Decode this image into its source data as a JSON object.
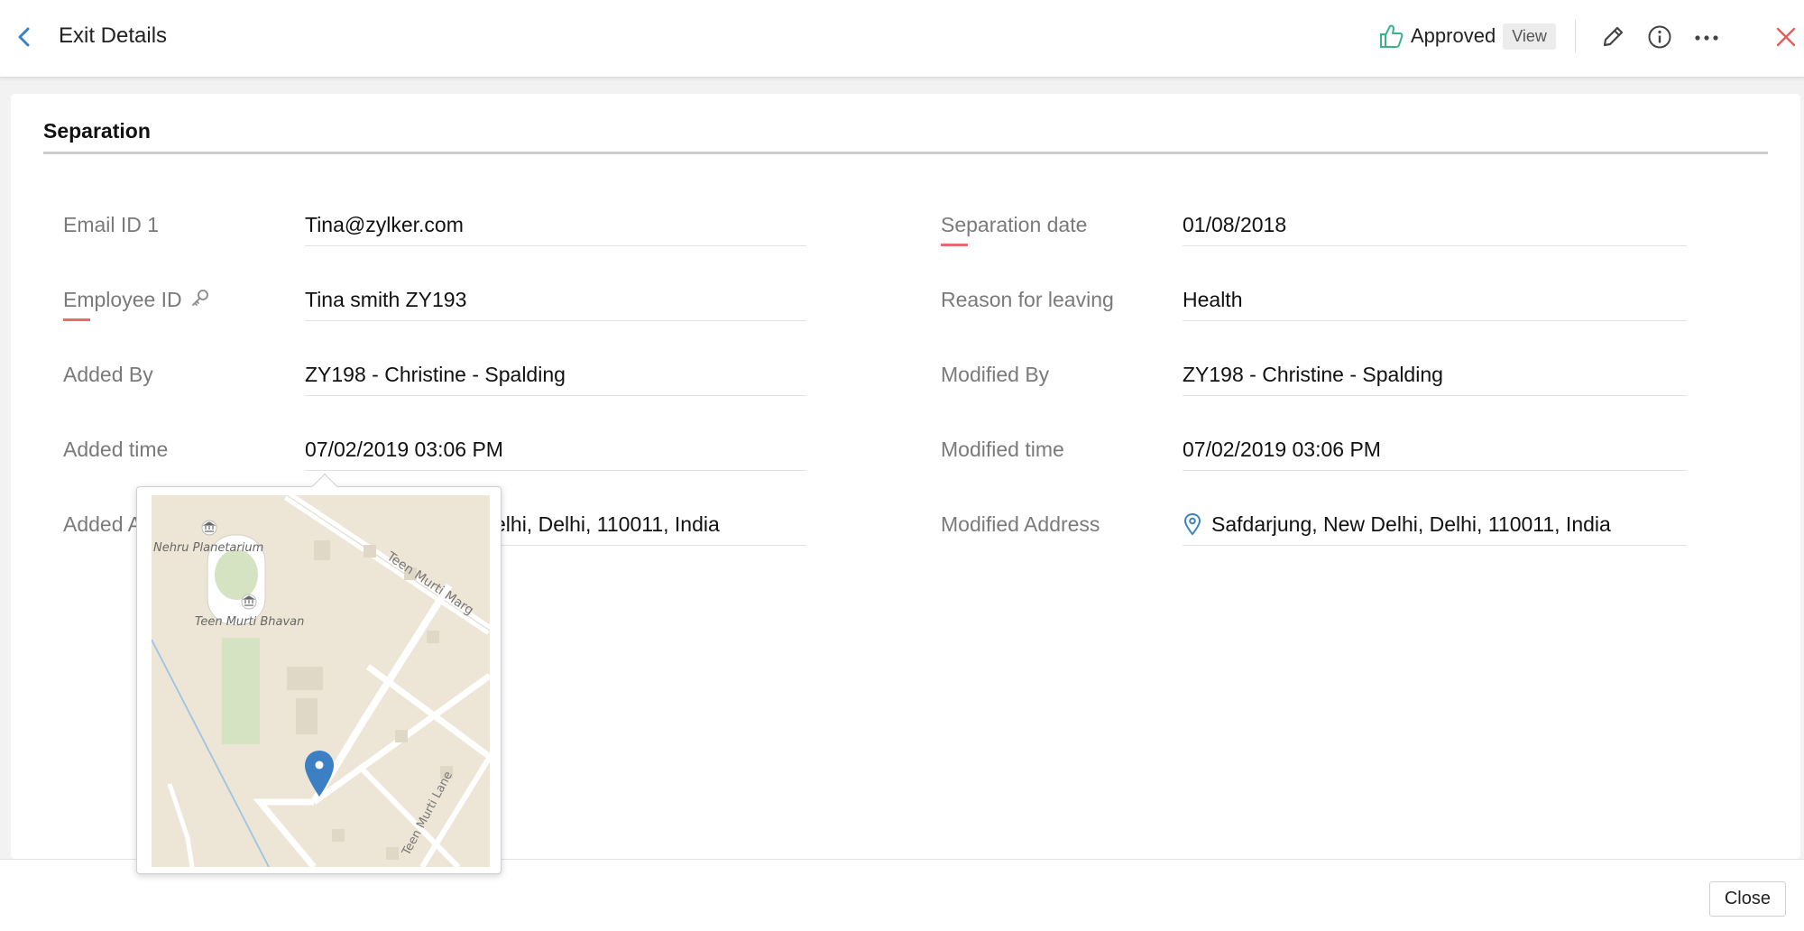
{
  "header": {
    "title": "Exit Details",
    "status": "Approved",
    "view_label": "View"
  },
  "section": {
    "title": "Separation"
  },
  "left_fields": [
    {
      "label": "Email ID 1",
      "value": "Tina@zylker.com"
    },
    {
      "label": "Employee ID",
      "value": "Tina smith ZY193"
    },
    {
      "label": "Added By",
      "value": "ZY198 - Christine - Spalding"
    },
    {
      "label": "Added time",
      "value": "07/02/2019 03:06 PM"
    },
    {
      "label": "Added A",
      "value": "elhi, Delhi, 110011, India"
    }
  ],
  "right_fields": [
    {
      "label": "Separation date",
      "value": "01/08/2018"
    },
    {
      "label": "Reason for leaving",
      "value": "Health"
    },
    {
      "label": "Modified By",
      "value": "ZY198 - Christine - Spalding"
    },
    {
      "label": "Modified time",
      "value": "07/02/2019 03:06 PM"
    },
    {
      "label": "Modified Address",
      "value": "Safdarjung, New Delhi, Delhi, 110011, India"
    }
  ],
  "map": {
    "labels": [
      "Nehru Planetarium",
      "Teen Murti Bhavan",
      "Teen Murti Marg",
      "Teen Murti Lane"
    ]
  },
  "footer": {
    "close_label": "Close"
  },
  "colors": {
    "accent": "#3b82c4",
    "approved": "#3bb38a",
    "close_x": "#e35d5d",
    "required": "#e86b6b",
    "map_pin": "#3d7fc4",
    "map_bg": "#ede6d6",
    "map_park": "#d6e3c3"
  },
  "icons": {
    "back": "chevron-left-icon",
    "approved": "thumbs-up-icon",
    "edit": "pencil-icon",
    "info": "info-icon",
    "more": "more-horizontal-icon",
    "close": "close-icon",
    "key": "key-icon",
    "location": "location-pin-icon"
  }
}
